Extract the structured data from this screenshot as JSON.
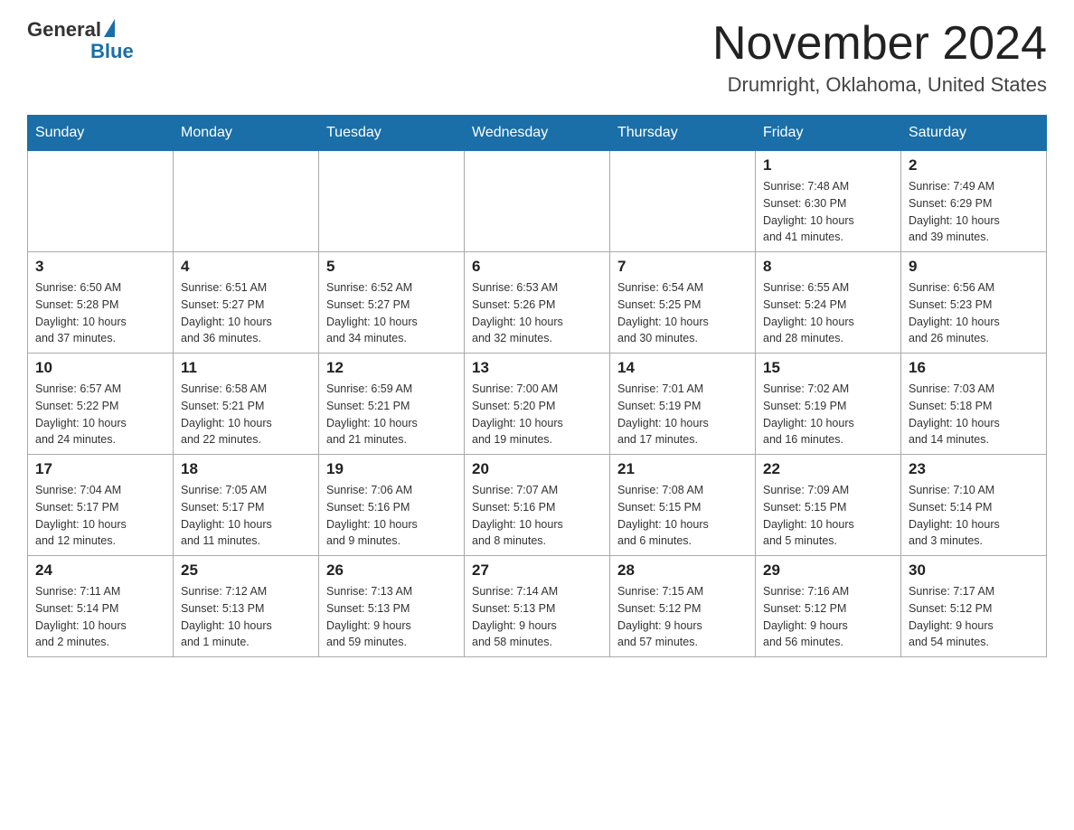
{
  "header": {
    "logo_general": "General",
    "logo_blue": "Blue",
    "month_title": "November 2024",
    "location": "Drumright, Oklahoma, United States"
  },
  "weekdays": [
    "Sunday",
    "Monday",
    "Tuesday",
    "Wednesday",
    "Thursday",
    "Friday",
    "Saturday"
  ],
  "weeks": [
    [
      {
        "day": "",
        "info": ""
      },
      {
        "day": "",
        "info": ""
      },
      {
        "day": "",
        "info": ""
      },
      {
        "day": "",
        "info": ""
      },
      {
        "day": "",
        "info": ""
      },
      {
        "day": "1",
        "info": "Sunrise: 7:48 AM\nSunset: 6:30 PM\nDaylight: 10 hours\nand 41 minutes."
      },
      {
        "day": "2",
        "info": "Sunrise: 7:49 AM\nSunset: 6:29 PM\nDaylight: 10 hours\nand 39 minutes."
      }
    ],
    [
      {
        "day": "3",
        "info": "Sunrise: 6:50 AM\nSunset: 5:28 PM\nDaylight: 10 hours\nand 37 minutes."
      },
      {
        "day": "4",
        "info": "Sunrise: 6:51 AM\nSunset: 5:27 PM\nDaylight: 10 hours\nand 36 minutes."
      },
      {
        "day": "5",
        "info": "Sunrise: 6:52 AM\nSunset: 5:27 PM\nDaylight: 10 hours\nand 34 minutes."
      },
      {
        "day": "6",
        "info": "Sunrise: 6:53 AM\nSunset: 5:26 PM\nDaylight: 10 hours\nand 32 minutes."
      },
      {
        "day": "7",
        "info": "Sunrise: 6:54 AM\nSunset: 5:25 PM\nDaylight: 10 hours\nand 30 minutes."
      },
      {
        "day": "8",
        "info": "Sunrise: 6:55 AM\nSunset: 5:24 PM\nDaylight: 10 hours\nand 28 minutes."
      },
      {
        "day": "9",
        "info": "Sunrise: 6:56 AM\nSunset: 5:23 PM\nDaylight: 10 hours\nand 26 minutes."
      }
    ],
    [
      {
        "day": "10",
        "info": "Sunrise: 6:57 AM\nSunset: 5:22 PM\nDaylight: 10 hours\nand 24 minutes."
      },
      {
        "day": "11",
        "info": "Sunrise: 6:58 AM\nSunset: 5:21 PM\nDaylight: 10 hours\nand 22 minutes."
      },
      {
        "day": "12",
        "info": "Sunrise: 6:59 AM\nSunset: 5:21 PM\nDaylight: 10 hours\nand 21 minutes."
      },
      {
        "day": "13",
        "info": "Sunrise: 7:00 AM\nSunset: 5:20 PM\nDaylight: 10 hours\nand 19 minutes."
      },
      {
        "day": "14",
        "info": "Sunrise: 7:01 AM\nSunset: 5:19 PM\nDaylight: 10 hours\nand 17 minutes."
      },
      {
        "day": "15",
        "info": "Sunrise: 7:02 AM\nSunset: 5:19 PM\nDaylight: 10 hours\nand 16 minutes."
      },
      {
        "day": "16",
        "info": "Sunrise: 7:03 AM\nSunset: 5:18 PM\nDaylight: 10 hours\nand 14 minutes."
      }
    ],
    [
      {
        "day": "17",
        "info": "Sunrise: 7:04 AM\nSunset: 5:17 PM\nDaylight: 10 hours\nand 12 minutes."
      },
      {
        "day": "18",
        "info": "Sunrise: 7:05 AM\nSunset: 5:17 PM\nDaylight: 10 hours\nand 11 minutes."
      },
      {
        "day": "19",
        "info": "Sunrise: 7:06 AM\nSunset: 5:16 PM\nDaylight: 10 hours\nand 9 minutes."
      },
      {
        "day": "20",
        "info": "Sunrise: 7:07 AM\nSunset: 5:16 PM\nDaylight: 10 hours\nand 8 minutes."
      },
      {
        "day": "21",
        "info": "Sunrise: 7:08 AM\nSunset: 5:15 PM\nDaylight: 10 hours\nand 6 minutes."
      },
      {
        "day": "22",
        "info": "Sunrise: 7:09 AM\nSunset: 5:15 PM\nDaylight: 10 hours\nand 5 minutes."
      },
      {
        "day": "23",
        "info": "Sunrise: 7:10 AM\nSunset: 5:14 PM\nDaylight: 10 hours\nand 3 minutes."
      }
    ],
    [
      {
        "day": "24",
        "info": "Sunrise: 7:11 AM\nSunset: 5:14 PM\nDaylight: 10 hours\nand 2 minutes."
      },
      {
        "day": "25",
        "info": "Sunrise: 7:12 AM\nSunset: 5:13 PM\nDaylight: 10 hours\nand 1 minute."
      },
      {
        "day": "26",
        "info": "Sunrise: 7:13 AM\nSunset: 5:13 PM\nDaylight: 9 hours\nand 59 minutes."
      },
      {
        "day": "27",
        "info": "Sunrise: 7:14 AM\nSunset: 5:13 PM\nDaylight: 9 hours\nand 58 minutes."
      },
      {
        "day": "28",
        "info": "Sunrise: 7:15 AM\nSunset: 5:12 PM\nDaylight: 9 hours\nand 57 minutes."
      },
      {
        "day": "29",
        "info": "Sunrise: 7:16 AM\nSunset: 5:12 PM\nDaylight: 9 hours\nand 56 minutes."
      },
      {
        "day": "30",
        "info": "Sunrise: 7:17 AM\nSunset: 5:12 PM\nDaylight: 9 hours\nand 54 minutes."
      }
    ]
  ]
}
